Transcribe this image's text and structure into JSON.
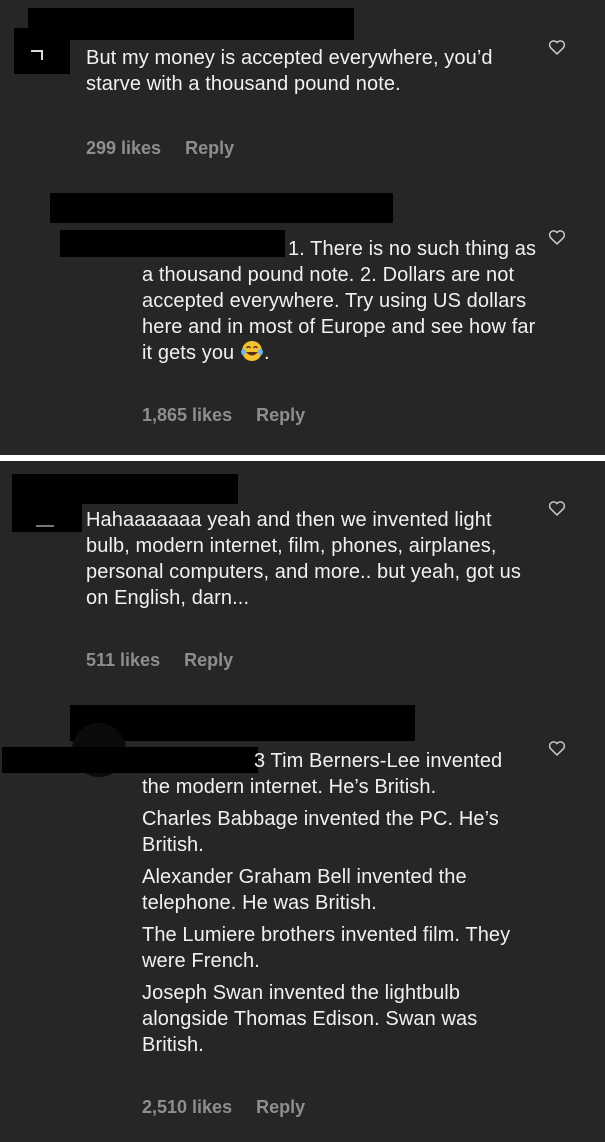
{
  "colors": {
    "panel_bg": "#262627",
    "text": "#f1f1f1",
    "meta_text": "#8e8e8e",
    "divider": "#ffffff"
  },
  "comments": [
    {
      "text": "But my money is accepted everywhere, you’d starve with a thousand pound note.",
      "likes": "299 likes",
      "reply": "Reply",
      "icon": "heart-outline-icon"
    },
    {
      "text": "1. There is no such thing as a thousand pound note. 2. Dollars are not accepted everywhere. Try using US dollars here and in most of Europe and see how far it gets you",
      "emoji": "tears-of-joy-emoji",
      "trailing": ".",
      "likes": "1,865 likes",
      "reply": "Reply",
      "icon": "heart-outline-icon"
    },
    {
      "text": "Hahaaaaaaa yeah and then we invented light bulb, modern internet, film, phones, airplanes, personal computers, and more.. but yeah, got us on English, darn...",
      "likes": "511 likes",
      "reply": "Reply",
      "icon": "heart-outline-icon"
    },
    {
      "paragraphs": [
        "3 Tim Berners-Lee invented the modern internet. He’s British.",
        "Charles Babbage invented the PC. He’s British.",
        "Alexander Graham Bell invented the telephone. He was British.",
        "The Lumiere brothers invented film. They were French.",
        "Joseph Swan invented the lightbulb alongside Thomas Edison. Swan was British."
      ],
      "likes": "2,510 likes",
      "reply": "Reply",
      "icon": "heart-outline-icon"
    }
  ]
}
